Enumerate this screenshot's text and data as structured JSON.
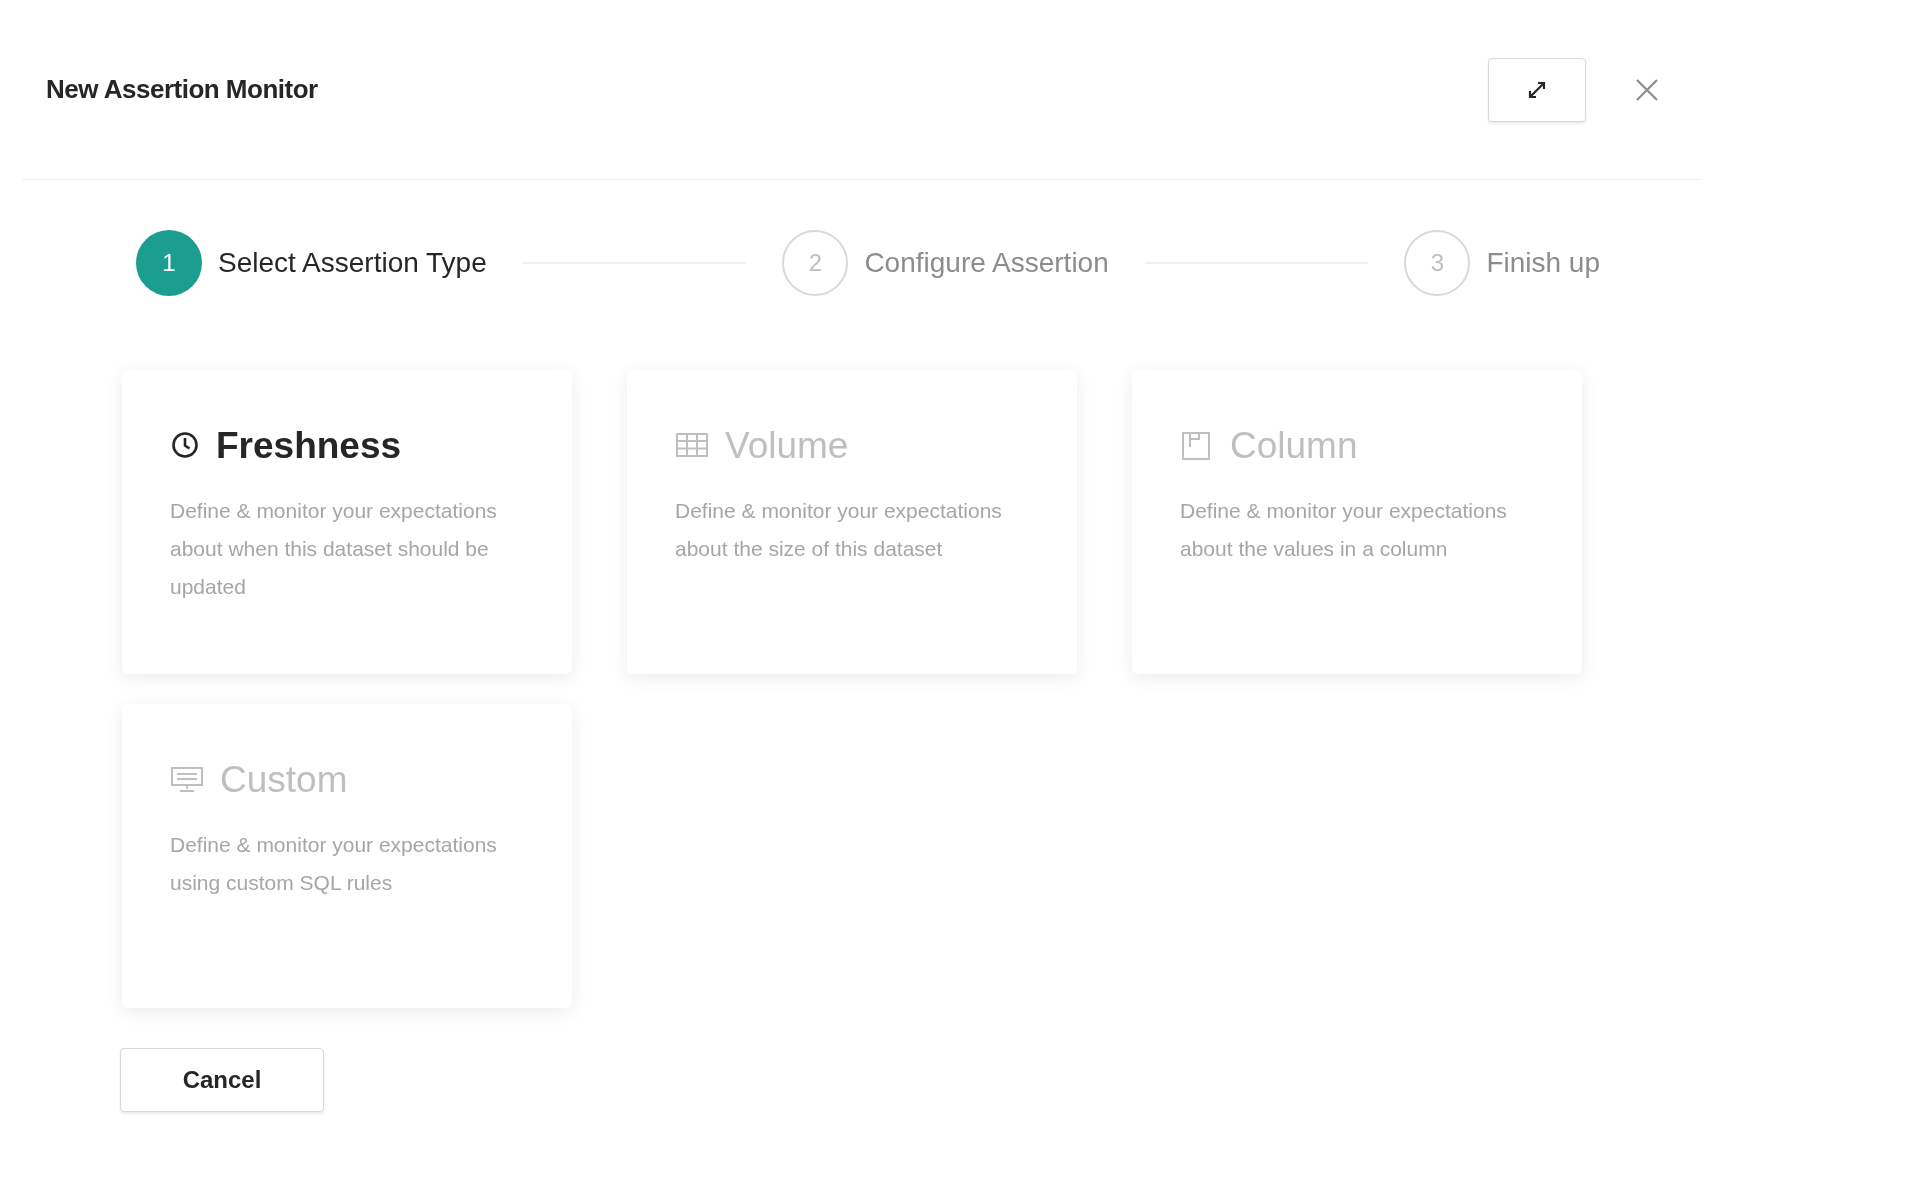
{
  "dialog": {
    "title": "New Assertion Monitor"
  },
  "steps": [
    {
      "number": "1",
      "label": "Select Assertion Type",
      "selected": true
    },
    {
      "number": "2",
      "label": "Configure Assertion",
      "selected": false
    },
    {
      "number": "3",
      "label": "Finish up",
      "selected": false
    }
  ],
  "cards": [
    {
      "kind": "clock",
      "title": "Freshness",
      "description": "Define & monitor your expectations about when this dataset should be updated",
      "disabled": false
    },
    {
      "kind": "table",
      "title": "Volume",
      "description": "Define & monitor your expectations about the size of this dataset",
      "disabled": true
    },
    {
      "kind": "column",
      "title": "Column",
      "description": "Define & monitor your expectations about the values in a column",
      "disabled": true
    },
    {
      "kind": "sql",
      "title": "Custom",
      "description": "Define & monitor your expectations using custom SQL rules",
      "disabled": true
    }
  ],
  "footer": {
    "cancel": "Cancel"
  }
}
